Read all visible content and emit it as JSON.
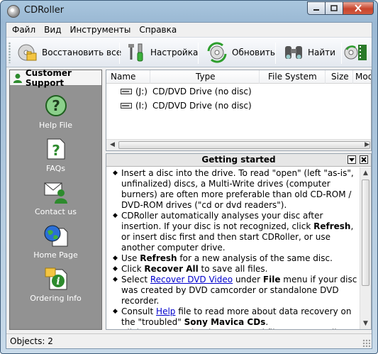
{
  "window": {
    "title": "CDRoller"
  },
  "menu": [
    "Файл",
    "Вид",
    "Инструменты",
    "Справка"
  ],
  "toolbar": {
    "restore_all": "Восстановить все",
    "settings": "Настройка",
    "refresh": "Обновить",
    "find": "Найти"
  },
  "sidebar": {
    "header": "Customer Support",
    "items": [
      {
        "label": "Help File",
        "icon": "question-circle-icon"
      },
      {
        "label": "FAQs",
        "icon": "question-document-icon"
      },
      {
        "label": "Contact us",
        "icon": "envelope-person-icon"
      },
      {
        "label": "Home Page",
        "icon": "globe-document-icon"
      },
      {
        "label": "Ordering Info",
        "icon": "info-document-icon"
      }
    ]
  },
  "filelist": {
    "columns": [
      "Name",
      "Type",
      "File System",
      "Size",
      "Modi"
    ],
    "rows": [
      {
        "name": "(J:)",
        "type": "CD/DVD Drive (no disc)"
      },
      {
        "name": "(I:)",
        "type": "CD/DVD Drive (no disc)"
      }
    ]
  },
  "panel": {
    "title": "Getting started",
    "items": [
      {
        "parts": [
          {
            "t": "Insert a disc into the drive. To read \"open\" (left \"as-is\", unfinalized) discs, a Multi-Write drives (computer burners) are often more preferable than old CD-ROM / DVD-ROM drives (\"cd or dvd readers\")."
          }
        ]
      },
      {
        "parts": [
          {
            "t": "CDRoller automatically analyses your disc after insertion. If your disc is not recognized, click "
          },
          {
            "t": "Refresh",
            "b": true
          },
          {
            "t": ", or insert disc first and then start CDRoller, or use another computer drive."
          }
        ]
      },
      {
        "parts": [
          {
            "t": "Use "
          },
          {
            "t": "Refresh",
            "b": true
          },
          {
            "t": " for a new analysis of the same disc."
          }
        ]
      },
      {
        "parts": [
          {
            "t": "Click "
          },
          {
            "t": "Recover All",
            "b": true
          },
          {
            "t": " to save all files."
          }
        ]
      },
      {
        "parts": [
          {
            "t": "Select "
          },
          {
            "t": "Recover DVD Video",
            "a": true
          },
          {
            "t": " under "
          },
          {
            "t": "File",
            "b": true
          },
          {
            "t": " menu if your disc was created by DVD camcorder or standalone DVD recorder."
          }
        ]
      },
      {
        "parts": [
          {
            "t": "Consult "
          },
          {
            "t": "Help",
            "a": true
          },
          {
            "t": " file to read more about data recovery on the \"troubled\" "
          },
          {
            "t": "Sony Mavica CDs",
            "b": true
          },
          {
            "t": "."
          }
        ]
      },
      {
        "parts": [
          {
            "t": "Click "
          },
          {
            "t": "Burn",
            "b": true
          },
          {
            "t": " to write the recovered files on a new disc, or create DVD with recovered video."
          }
        ]
      }
    ]
  },
  "status": {
    "text": "Objects: 2"
  },
  "colors": {
    "sidebar_bg": "#929292",
    "link": "#0000cc",
    "close_button": "#c8452d"
  }
}
